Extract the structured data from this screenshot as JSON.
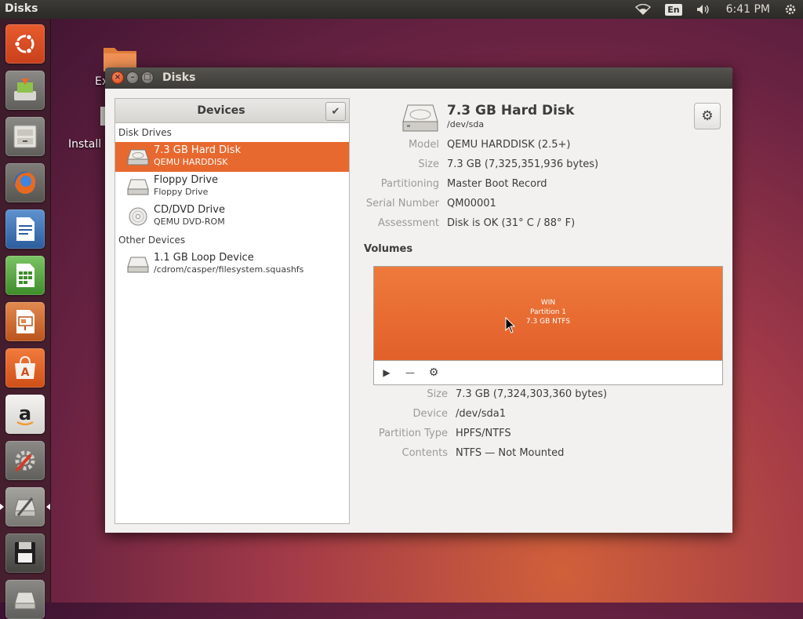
{
  "top_panel": {
    "title": "Disks",
    "keyboard_layout": "En",
    "clock": "6:41 PM"
  },
  "launcher": {
    "items": [
      {
        "name": "ubuntu-dash-icon"
      },
      {
        "name": "software-updater-icon"
      },
      {
        "name": "files-icon"
      },
      {
        "name": "firefox-icon"
      },
      {
        "name": "libreoffice-writer-icon"
      },
      {
        "name": "libreoffice-calc-icon"
      },
      {
        "name": "libreoffice-impress-icon"
      },
      {
        "name": "ubuntu-software-center-icon"
      },
      {
        "name": "amazon-icon"
      },
      {
        "name": "system-settings-icon"
      },
      {
        "name": "disks-icon"
      },
      {
        "name": "floppy-icon"
      },
      {
        "name": "removable-drive-icon"
      }
    ]
  },
  "desktop": {
    "icons": [
      {
        "label": "Ex"
      },
      {
        "label": "Install U"
      }
    ]
  },
  "window": {
    "title": "Disks",
    "devices_panel": {
      "header": "Devices",
      "sections": [
        {
          "title": "Disk Drives",
          "items": [
            {
              "name": "7.3 GB Hard Disk",
              "sub": "QEMU HARDDISK",
              "icon": "hard-disk-icon",
              "selected": true
            },
            {
              "name": "Floppy Drive",
              "sub": "Floppy Drive",
              "icon": "floppy-drive-icon",
              "selected": false
            },
            {
              "name": "CD/DVD Drive",
              "sub": "QEMU DVD-ROM",
              "icon": "optical-disc-icon",
              "selected": false
            }
          ]
        },
        {
          "title": "Other Devices",
          "items": [
            {
              "name": "1.1 GB Loop Device",
              "sub": "/cdrom/casper/filesystem.squashfs",
              "icon": "loop-device-icon",
              "selected": false
            }
          ]
        }
      ]
    },
    "disk": {
      "title": "7.3 GB Hard Disk",
      "device": "/dev/sda",
      "properties": [
        {
          "key": "Model",
          "value": "QEMU HARDDISK (2.5+)"
        },
        {
          "key": "Size",
          "value": "7.3 GB (7,325,351,936 bytes)"
        },
        {
          "key": "Partitioning",
          "value": "Master Boot Record"
        },
        {
          "key": "Serial Number",
          "value": "QM00001"
        },
        {
          "key": "Assessment",
          "value": "Disk is OK (31° C / 88° F)"
        }
      ]
    },
    "volumes": {
      "heading": "Volumes",
      "partition": {
        "label": "WIN",
        "number": "Partition 1",
        "summary": "7.3 GB NTFS"
      },
      "properties": [
        {
          "key": "Size",
          "value": "7.3 GB (7,324,303,360 bytes)"
        },
        {
          "key": "Device",
          "value": "/dev/sda1"
        },
        {
          "key": "Partition Type",
          "value": "HPFS/NTFS"
        },
        {
          "key": "Contents",
          "value": "NTFS — Not Mounted"
        }
      ]
    }
  },
  "colors": {
    "accent": "#e8692f",
    "panel": "#3c3b37",
    "window_bg": "#f2f1f0"
  }
}
